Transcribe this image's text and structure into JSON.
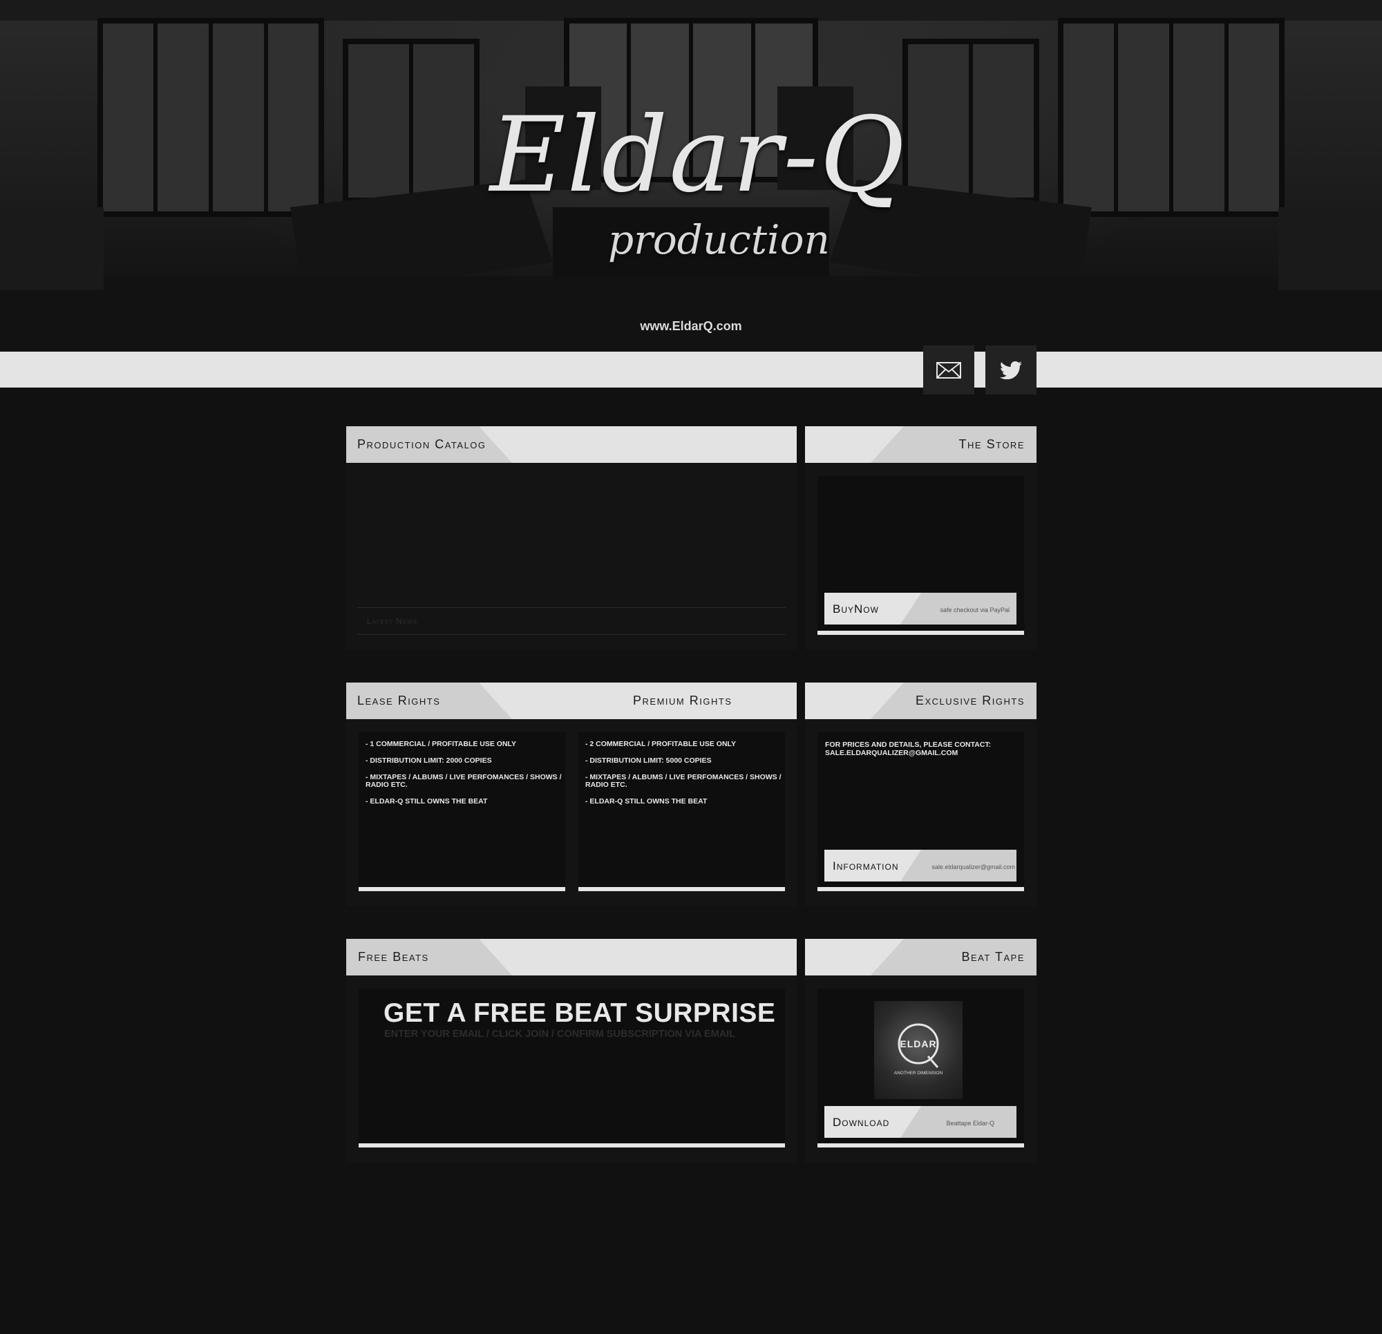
{
  "hero": {
    "logo_title": "Eldar-Q",
    "logo_subtitle": "production",
    "url": "www.EldarQ.com"
  },
  "nav": {
    "icons": [
      "mail-icon",
      "twitter-icon"
    ]
  },
  "panels": {
    "catalog": {
      "title": "Production Catalog",
      "latest_news": "Latest News"
    },
    "store": {
      "title": "The Store",
      "action_label": "BuyNow",
      "action_note": "safe checkout via PayPal"
    },
    "lease": {
      "title": "Lease Rights",
      "items": [
        "- 1 COMMERCIAL / PROFITABLE USE ONLY",
        "- DISTRIBUTION LIMIT: 2000 COPIES",
        "- MIXTAPES / ALBUMS / LIVE PERFOMANCES / SHOWS / RADIO ETC.",
        "- ELDAR-Q STILL OWNS THE BEAT"
      ]
    },
    "premium": {
      "title": "Premium Rights",
      "items": [
        "- 2 COMMERCIAL / PROFITABLE USE ONLY",
        "- DISTRIBUTION LIMIT: 5000 COPIES",
        "- MIXTAPES / ALBUMS / LIVE PERFOMANCES / SHOWS / RADIO ETC.",
        "- ELDAR-Q STILL OWNS THE BEAT"
      ]
    },
    "exclusive": {
      "title": "Exclusive Rights",
      "text": "FOR PRICES AND DETAILS, PLEASE CONTACT: SALE.ELDARQUALIZER@GMAIL.COM",
      "action_label": "Information",
      "action_note": "sale.eldarqualizer@gmail.com"
    },
    "free_beats": {
      "title": "Free Beats",
      "headline": "GET A FREE BEAT SURPRISE",
      "subline": "ENTER YOUR EMAIL / CLICK JOIN / CONFIRM SUBSCRIPTION VIA EMAIL"
    },
    "beat_tape": {
      "title": "Beat Tape",
      "cover_text": "ELDAR",
      "cover_sub": "ANOTHER DIMENSION",
      "action_label": "Download",
      "action_note": "Beattape Eldar-Q"
    }
  }
}
